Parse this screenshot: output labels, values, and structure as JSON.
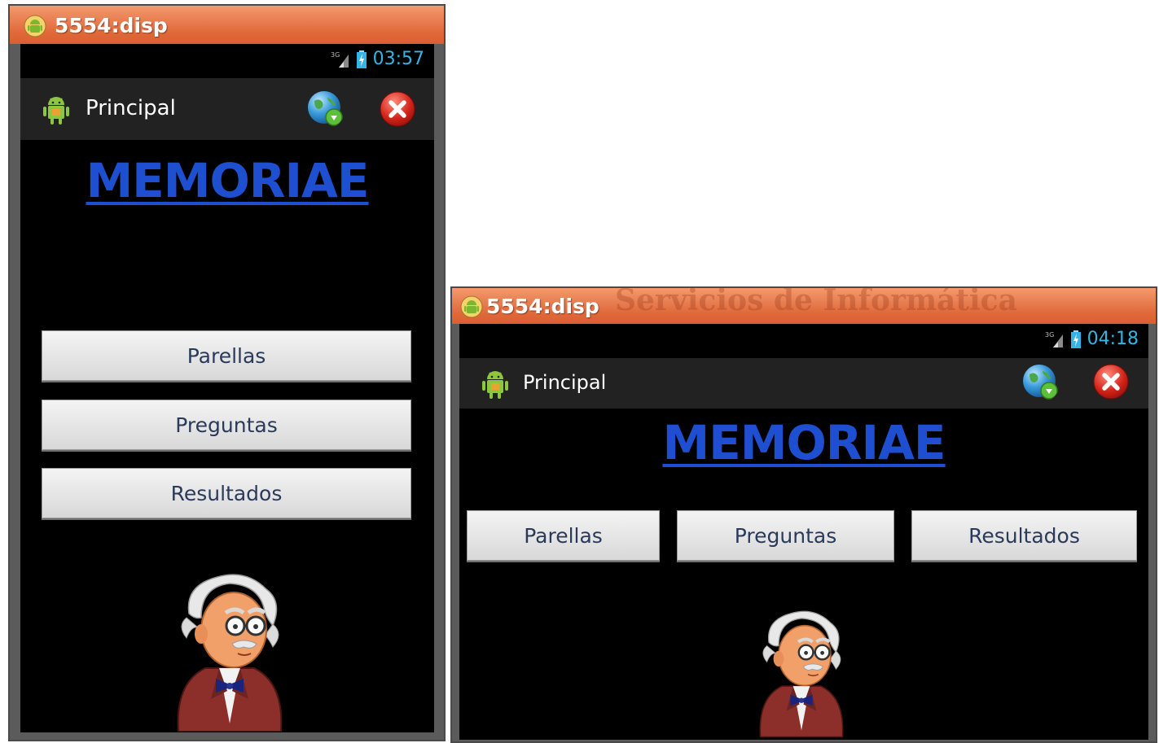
{
  "portrait": {
    "window_title": "5554:disp",
    "status": {
      "time": "03:57"
    },
    "actionbar": {
      "title": "Principal"
    },
    "heading": "MEMORIAE",
    "buttons": [
      "Parellas",
      "Preguntas",
      "Resultados"
    ]
  },
  "landscape": {
    "window_title": "5554:disp",
    "window_bg_text": "Servicios de Informática",
    "status": {
      "time": "04:18"
    },
    "actionbar": {
      "title": "Principal"
    },
    "heading": "MEMORIAE",
    "buttons": [
      "Parellas",
      "Preguntas",
      "Resultados"
    ]
  },
  "icons": {
    "window": "android-robot-icon",
    "app": "android-launcher-icon",
    "globe": "globe-icon",
    "close": "close-icon",
    "signal": "signal-3g-icon",
    "battery": "battery-charging-icon",
    "mascot": "professor-illustration"
  },
  "colors": {
    "title_bar": "#e0693a",
    "heading": "#1f4fd1",
    "clock": "#33b5e5",
    "screen_bg": "#000000",
    "actionbar_bg": "#222222"
  }
}
